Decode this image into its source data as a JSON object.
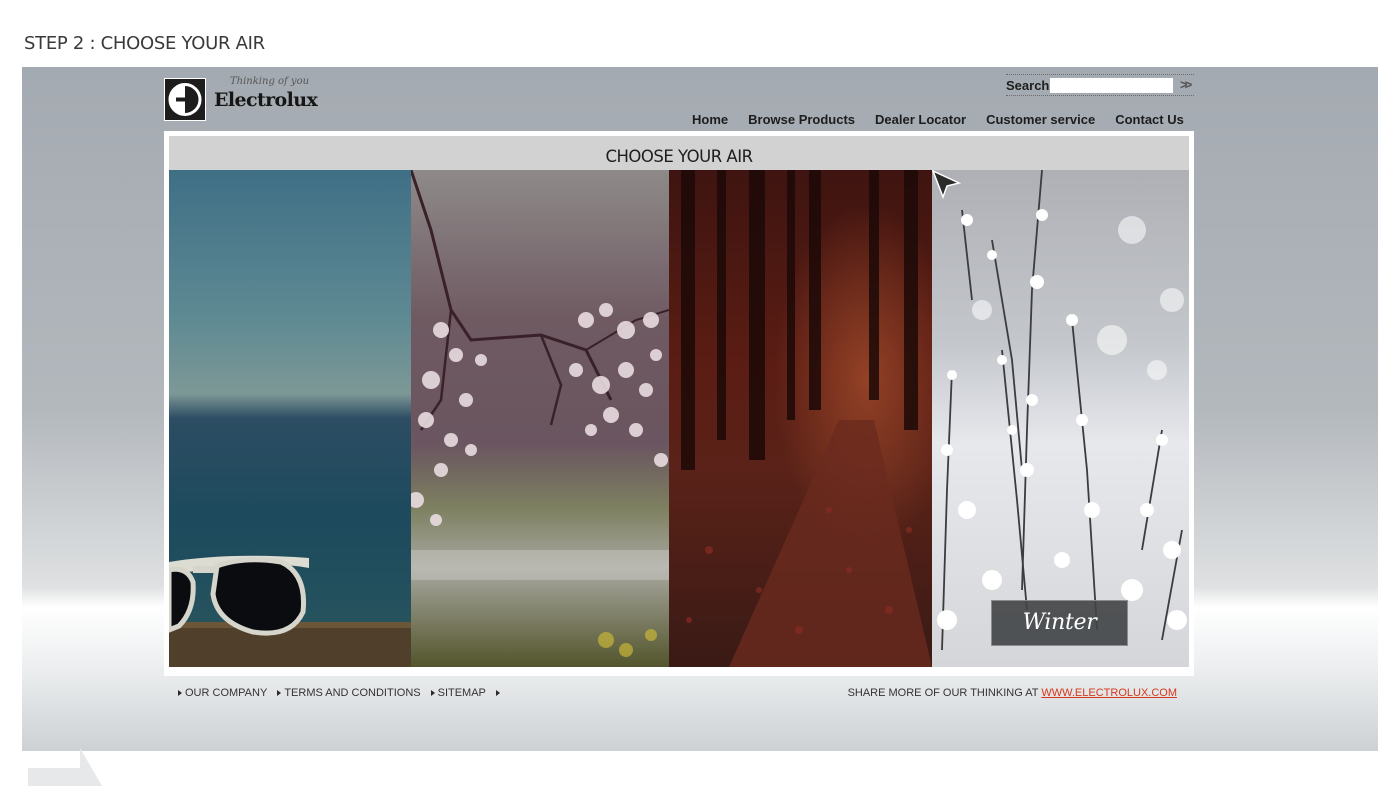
{
  "step_title": "STEP 2 : CHOOSE YOUR AIR",
  "brand": {
    "name": "Electrolux",
    "tagline": "Thinking of you"
  },
  "search": {
    "label": "Search",
    "value": "",
    "placeholder": "",
    "submit_icon": "double-chevron-right-icon"
  },
  "nav": {
    "items": [
      "Home",
      "Browse Products",
      "Dealer Locator",
      "Customer service",
      "Contact Us"
    ],
    "active": "Home"
  },
  "panel": {
    "title": "CHOOSE YOUR AIR",
    "hovered_label": "Winter"
  },
  "footer": {
    "links": [
      "OUR COMPANY",
      "TERMS AND CONDITIONS",
      "SITEMAP",
      ""
    ],
    "share_text": "SHARE MORE OF OUR THINKING AT",
    "share_link": "WWW.ELECTROLUX.COM"
  },
  "colors": {
    "accent": "#e3401f",
    "link": "#d8381b",
    "frame": "#a4aab1"
  }
}
